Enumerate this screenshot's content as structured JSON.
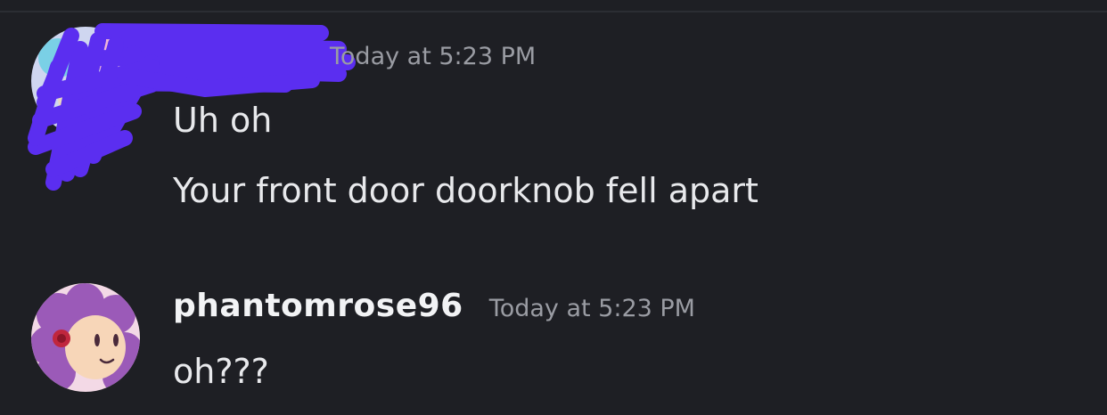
{
  "colors": {
    "background": "#1e1f24",
    "username": "#f2f3f5",
    "timestamp": "#9a9ca3",
    "message_text": "#e8e9ec",
    "redaction_scribble": "#5b2ef0"
  },
  "messages": [
    {
      "author": "",
      "author_redacted": true,
      "timestamp": "Today at 5:23 PM",
      "lines": [
        "Uh oh",
        "Your front door doorknob fell apart"
      ]
    },
    {
      "author": "phantomrose96",
      "author_redacted": false,
      "timestamp": "Today at 5:23 PM",
      "lines": [
        "oh???"
      ]
    }
  ]
}
